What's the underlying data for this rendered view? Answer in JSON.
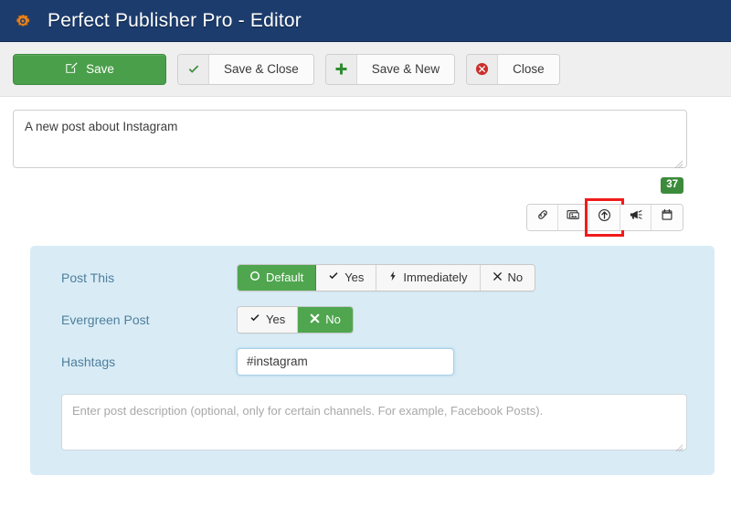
{
  "header": {
    "icon": "gear-icon",
    "title": "Perfect Publisher Pro - Editor",
    "bg_color": "#1c3c6e",
    "icon_color": "#e8821e"
  },
  "toolbar": {
    "save_label": "Save",
    "save_icon": "edit-square-icon",
    "save_color": "#4a9f4a",
    "buttons": [
      {
        "label": "Save & Close",
        "icon": "check-icon",
        "icon_color": "#3f8b3f"
      },
      {
        "label": "Save & New",
        "icon": "plus-icon",
        "icon_color": "#2f8c2f"
      },
      {
        "label": "Close",
        "icon": "times-circle-icon",
        "icon_color": "#c9302c"
      }
    ]
  },
  "message": {
    "value": "A new post about Instagram",
    "placeholder": "",
    "char_counter": "37",
    "counter_color": "#3c8b3c"
  },
  "icon_toolbar": {
    "buttons": [
      {
        "name": "link-icon",
        "title": "Link",
        "highlighted": false
      },
      {
        "name": "images-icon",
        "title": "Images",
        "highlighted": false
      },
      {
        "name": "upload-circle-icon",
        "title": "Upload",
        "highlighted": true
      },
      {
        "name": "megaphone-icon",
        "title": "Promote",
        "highlighted": false
      },
      {
        "name": "calendar-icon",
        "title": "Schedule",
        "highlighted": false
      }
    ],
    "highlight_color": "#f01b1b"
  },
  "panel": {
    "bg_color": "#d9ecf6",
    "label_color": "#4f7e9c",
    "active_color": "#4fa64f",
    "fields": [
      {
        "label": "Post This",
        "type": "button-group",
        "options": [
          {
            "label": "Default",
            "icon": "circle-o-icon",
            "active": true
          },
          {
            "label": "Yes",
            "icon": "check-icon",
            "active": false
          },
          {
            "label": "Immediately",
            "icon": "bolt-icon",
            "active": false
          },
          {
            "label": "No",
            "icon": "times-icon",
            "active": false
          }
        ]
      },
      {
        "label": "Evergreen Post",
        "type": "button-group",
        "options": [
          {
            "label": "Yes",
            "icon": "check-icon",
            "active": false
          },
          {
            "label": "No",
            "icon": "times-icon",
            "active": true
          }
        ]
      },
      {
        "label": "Hashtags",
        "type": "text",
        "value": "#instagram",
        "placeholder": ""
      }
    ],
    "description": {
      "value": "",
      "placeholder": "Enter post description (optional, only for certain channels. For example, Facebook Posts)."
    }
  }
}
